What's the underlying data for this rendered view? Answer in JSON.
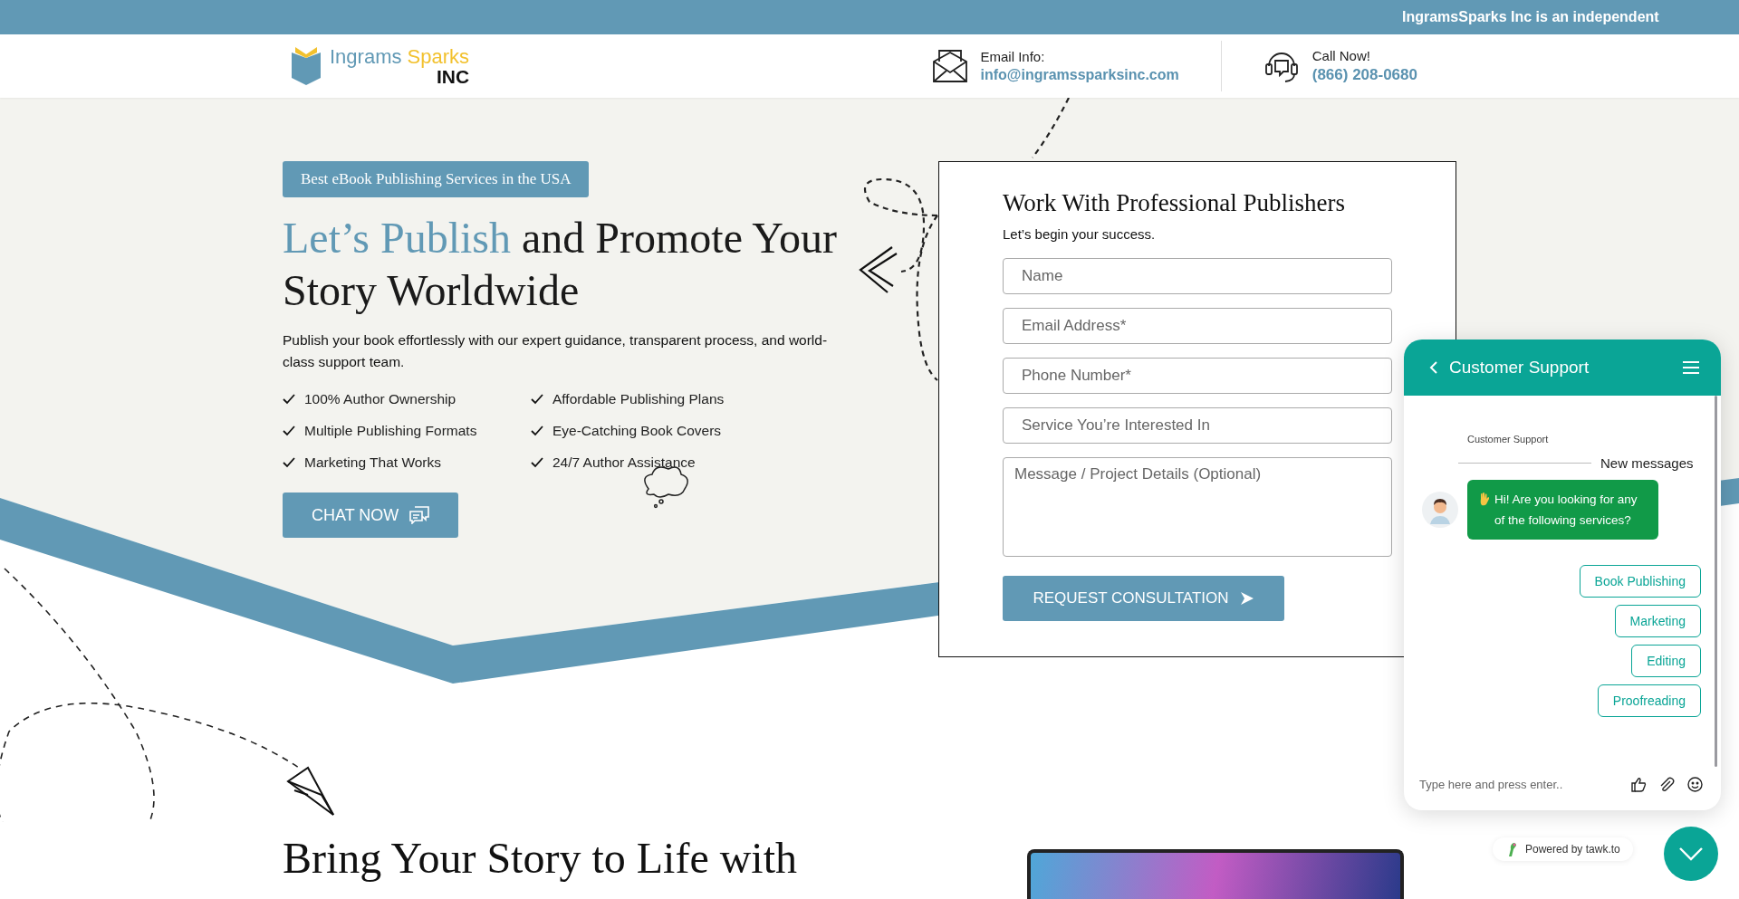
{
  "announcement_bar": {
    "text": "IngramsSparks Inc is an independent"
  },
  "header": {
    "logo": {
      "word_1": "Ingrams",
      "word_2": "Sparks",
      "word_3": "INC"
    },
    "contacts": [
      {
        "kind": "email",
        "label": "Email Info:",
        "value": "info@ingramssparksinc.com"
      },
      {
        "kind": "phone",
        "label": "Call Now!",
        "value": "(866) 208-0680"
      }
    ]
  },
  "hero": {
    "badge": "Best eBook Publishing Services in the USA",
    "headline_highlight": "Let’s Publish",
    "headline_rest": "and Promote Your Story Worldwide",
    "description": "Publish your book effortlessly with our expert guidance, transparent process, and world-class support team.",
    "features": [
      "100% Author Ownership",
      "Affordable Publishing Plans",
      "Multiple Publishing Formats",
      "Eye-Catching Book Covers",
      "Marketing That Works",
      "24/7 Author Assistance"
    ],
    "chat_button": "CHAT NOW"
  },
  "form": {
    "title": "Work With Professional Publishers",
    "subtitle": "Let’s begin your success.",
    "fields": [
      {
        "kind": "input",
        "placeholder": "Name"
      },
      {
        "kind": "input",
        "placeholder": "Email Address*"
      },
      {
        "kind": "input",
        "placeholder": "Phone Number*"
      },
      {
        "kind": "input",
        "placeholder": "Service You’re Interested In"
      },
      {
        "kind": "textarea",
        "placeholder": "Message / Project Details (Optional)"
      }
    ],
    "submit": "REQUEST CONSULTATION"
  },
  "section": {
    "heading": "Bring Your Story to Life with"
  },
  "chat_widget": {
    "title": "Customer Support",
    "agent_label": "Customer Support",
    "divider_label": "New messages",
    "message": "Hi! Are you looking for any of the following services?",
    "options": [
      "Book Publishing",
      "Marketing",
      "Editing",
      "Proofreading"
    ],
    "input_placeholder": "Type here and press enter..",
    "powered_by": "Powered by tawk.to"
  }
}
